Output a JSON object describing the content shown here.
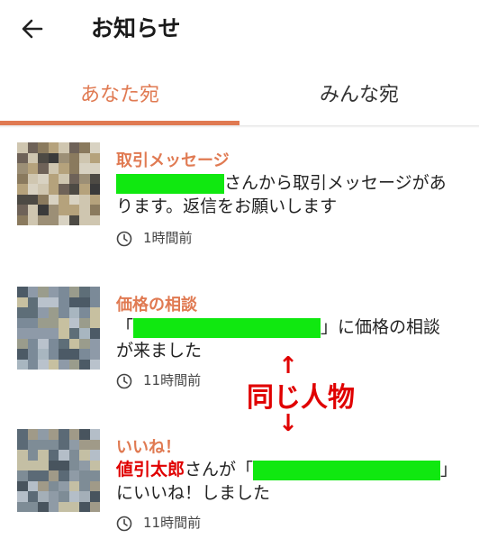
{
  "header": {
    "title": "お知らせ",
    "back_icon": "arrow-left-icon"
  },
  "tabs": [
    {
      "label": "あなた宛",
      "active": true
    },
    {
      "label": "みんな宛",
      "active": false
    }
  ],
  "colors": {
    "accent": "#e07a52",
    "redacted": "#10e810",
    "annotation": "#e00000"
  },
  "notifications": [
    {
      "category": "取引メッセージ",
      "message_tail": "さんから取引メッセージがあ",
      "message_line2": "ります。返信をお願いします",
      "time": "1時間前"
    },
    {
      "category": "価格の相談",
      "open_quote": "「",
      "close_quote_text": "」に価格の相談",
      "message_line2": "が来ました",
      "time": "11時間前"
    },
    {
      "category": "いいね！",
      "user_name": "値引太郎",
      "mid_text": "さんが「",
      "close_quote": "」",
      "message_line2": "にいいね！しました",
      "time": "11時間前"
    }
  ],
  "annotation": {
    "text": "同じ人物",
    "arrow_up": "↑",
    "arrow_down": "↓"
  }
}
